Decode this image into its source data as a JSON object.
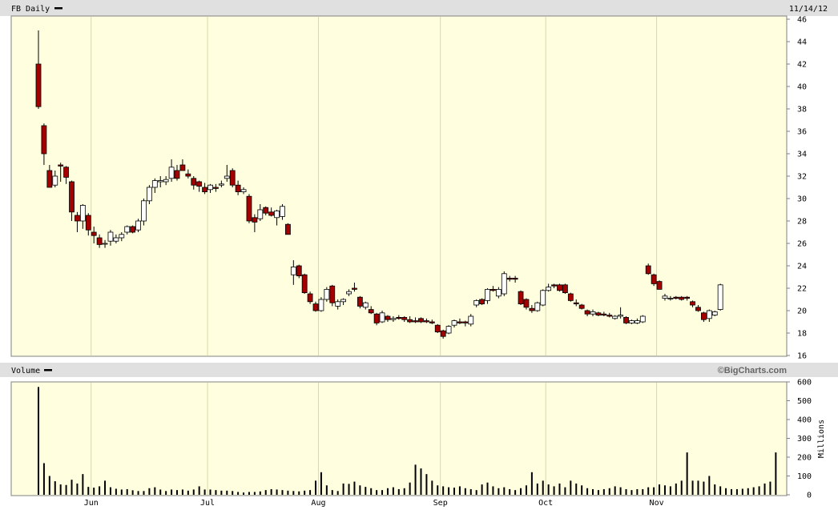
{
  "header": {
    "title": "FB Daily",
    "date": "11/14/12",
    "volume_title": "Volume",
    "copyright": "©BigCharts.com"
  },
  "colors": {
    "panel_bg": "#ffffe0",
    "grid": "#d8d8a0",
    "down": "#a40000",
    "up": "#ffffff",
    "header_bg": "#e0e0e0"
  },
  "chart_data": [
    {
      "type": "candlestick",
      "title": "FB Daily",
      "ylim": [
        16,
        46
      ],
      "yticks": [
        16,
        18,
        20,
        22,
        24,
        26,
        28,
        30,
        32,
        34,
        36,
        38,
        40,
        42,
        44,
        46
      ],
      "x_labels": [
        {
          "label": "Jun",
          "index": 10
        },
        {
          "label": "Jul",
          "index": 31
        },
        {
          "label": "Aug",
          "index": 51
        },
        {
          "label": "Sep",
          "index": 73
        },
        {
          "label": "Oct",
          "index": 92
        },
        {
          "label": "Nov",
          "index": 112
        }
      ],
      "ohlc": [
        [
          42.0,
          45.0,
          38.0,
          38.2
        ],
        [
          36.5,
          36.7,
          33.0,
          34.0
        ],
        [
          32.5,
          33.0,
          31.0,
          31.0
        ],
        [
          31.2,
          32.5,
          31.0,
          32.0
        ],
        [
          33.0,
          33.2,
          31.5,
          32.9
        ],
        [
          32.8,
          32.9,
          31.3,
          31.9
        ],
        [
          31.5,
          31.6,
          28.0,
          28.8
        ],
        [
          28.5,
          28.8,
          27.0,
          28.0
        ],
        [
          28.0,
          29.5,
          27.3,
          29.4
        ],
        [
          28.5,
          28.7,
          26.7,
          27.2
        ],
        [
          27.0,
          27.5,
          26.0,
          26.7
        ],
        [
          26.5,
          26.8,
          25.6,
          25.9
        ],
        [
          26.0,
          26.3,
          25.6,
          26.0
        ],
        [
          26.2,
          27.2,
          25.8,
          27.0
        ],
        [
          26.2,
          26.8,
          26.0,
          26.5
        ],
        [
          26.5,
          27.0,
          26.2,
          26.8
        ],
        [
          27.0,
          27.6,
          26.8,
          27.5
        ],
        [
          27.5,
          27.6,
          26.9,
          27.0
        ],
        [
          27.2,
          28.2,
          27.0,
          28.0
        ],
        [
          28.0,
          30.0,
          27.6,
          29.8
        ],
        [
          29.8,
          31.2,
          29.5,
          31.0
        ],
        [
          31.0,
          31.8,
          30.5,
          31.6
        ],
        [
          31.5,
          32.0,
          31.0,
          31.6
        ],
        [
          31.5,
          32.0,
          31.2,
          31.7
        ],
        [
          31.8,
          33.5,
          31.5,
          32.8
        ],
        [
          32.5,
          33.0,
          31.6,
          31.8
        ],
        [
          33.0,
          33.5,
          32.5,
          32.5
        ],
        [
          32.2,
          32.6,
          31.8,
          32.0
        ],
        [
          31.8,
          32.0,
          30.8,
          31.2
        ],
        [
          31.5,
          31.6,
          30.6,
          31.1
        ],
        [
          31.0,
          31.4,
          30.4,
          30.6
        ],
        [
          30.8,
          31.3,
          30.5,
          31.2
        ],
        [
          31.0,
          31.3,
          30.6,
          30.9
        ],
        [
          31.2,
          31.6,
          31.0,
          31.3
        ],
        [
          31.8,
          33.0,
          31.5,
          32.0
        ],
        [
          32.5,
          32.7,
          31.0,
          31.2
        ],
        [
          31.2,
          31.6,
          30.3,
          30.6
        ],
        [
          30.6,
          31.0,
          30.4,
          30.8
        ],
        [
          30.2,
          30.4,
          27.8,
          28.0
        ],
        [
          28.3,
          28.6,
          27.0,
          27.9
        ],
        [
          28.2,
          29.5,
          28.0,
          29.0
        ],
        [
          29.2,
          29.3,
          28.5,
          28.7
        ],
        [
          28.8,
          29.2,
          28.4,
          28.5
        ],
        [
          28.3,
          29.0,
          27.6,
          28.9
        ],
        [
          28.4,
          29.5,
          28.1,
          29.3
        ],
        [
          27.7,
          27.8,
          26.8,
          26.8
        ],
        [
          23.2,
          24.5,
          22.3,
          23.9
        ],
        [
          24.0,
          24.1,
          22.9,
          23.1
        ],
        [
          23.2,
          23.3,
          21.5,
          21.6
        ],
        [
          21.5,
          21.7,
          20.6,
          20.8
        ],
        [
          20.6,
          20.8,
          19.9,
          20.0
        ],
        [
          20.0,
          21.2,
          19.9,
          21.0
        ],
        [
          21.0,
          22.1,
          20.8,
          21.9
        ],
        [
          22.2,
          22.3,
          20.4,
          20.7
        ],
        [
          20.4,
          21.0,
          20.1,
          20.8
        ],
        [
          20.8,
          21.1,
          20.5,
          21.0
        ],
        [
          21.5,
          21.9,
          21.3,
          21.7
        ],
        [
          22.0,
          22.5,
          21.7,
          21.9
        ],
        [
          21.2,
          21.3,
          20.2,
          20.4
        ],
        [
          20.3,
          20.8,
          20.1,
          20.7
        ],
        [
          20.1,
          20.4,
          19.7,
          19.8
        ],
        [
          19.7,
          19.8,
          18.7,
          18.9
        ],
        [
          19.0,
          20.0,
          18.9,
          19.8
        ],
        [
          19.5,
          19.6,
          19.0,
          19.2
        ],
        [
          19.2,
          19.5,
          19.0,
          19.3
        ],
        [
          19.4,
          19.6,
          19.2,
          19.3
        ],
        [
          19.4,
          19.5,
          19.0,
          19.2
        ],
        [
          19.2,
          19.5,
          18.9,
          19.0
        ],
        [
          19.1,
          19.4,
          18.9,
          19.0
        ],
        [
          19.3,
          19.4,
          18.9,
          19.0
        ],
        [
          19.1,
          19.3,
          18.9,
          19.0
        ],
        [
          19.0,
          19.2,
          18.8,
          18.9
        ],
        [
          18.7,
          18.8,
          18.0,
          18.1
        ],
        [
          18.2,
          18.3,
          17.5,
          17.7
        ],
        [
          18.0,
          18.7,
          17.9,
          18.6
        ],
        [
          18.7,
          19.2,
          18.5,
          19.1
        ],
        [
          19.0,
          19.3,
          18.8,
          18.9
        ],
        [
          19.0,
          19.1,
          18.6,
          18.9
        ],
        [
          18.8,
          19.7,
          18.6,
          19.5
        ],
        [
          20.5,
          21.0,
          20.3,
          20.9
        ],
        [
          21.0,
          21.1,
          20.5,
          20.6
        ],
        [
          20.9,
          22.0,
          20.6,
          21.9
        ],
        [
          21.9,
          22.2,
          21.7,
          21.8
        ],
        [
          21.3,
          22.1,
          21.1,
          21.9
        ],
        [
          21.5,
          23.5,
          21.3,
          23.3
        ],
        [
          22.9,
          23.1,
          22.6,
          22.8
        ],
        [
          22.9,
          23.1,
          22.5,
          22.8
        ],
        [
          21.7,
          21.8,
          20.5,
          20.6
        ],
        [
          21.0,
          21.1,
          20.1,
          20.3
        ],
        [
          20.2,
          20.5,
          19.8,
          20.0
        ],
        [
          20.0,
          20.8,
          19.9,
          20.7
        ],
        [
          20.5,
          21.9,
          20.4,
          21.8
        ],
        [
          21.8,
          22.4,
          21.7,
          22.1
        ],
        [
          22.3,
          22.4,
          22.0,
          22.2
        ],
        [
          22.3,
          22.4,
          21.7,
          21.8
        ],
        [
          22.3,
          22.4,
          21.5,
          21.6
        ],
        [
          21.5,
          21.6,
          20.8,
          20.9
        ],
        [
          20.7,
          21.0,
          20.4,
          20.6
        ],
        [
          20.5,
          20.6,
          20.1,
          20.2
        ],
        [
          20.0,
          20.1,
          19.5,
          19.7
        ],
        [
          19.7,
          20.1,
          19.5,
          19.9
        ],
        [
          19.8,
          19.9,
          19.5,
          19.6
        ],
        [
          19.7,
          19.9,
          19.5,
          19.6
        ],
        [
          19.6,
          19.8,
          19.4,
          19.5
        ],
        [
          19.3,
          19.6,
          19.2,
          19.5
        ],
        [
          19.5,
          20.3,
          19.3,
          19.6
        ],
        [
          19.4,
          19.5,
          18.8,
          18.9
        ],
        [
          18.9,
          19.2,
          18.8,
          19.1
        ],
        [
          18.9,
          19.3,
          18.8,
          19.1
        ],
        [
          19.0,
          19.6,
          18.9,
          19.5
        ],
        [
          24.0,
          24.2,
          23.2,
          23.3
        ],
        [
          23.2,
          23.3,
          22.2,
          22.4
        ],
        [
          22.6,
          22.7,
          21.9,
          21.9
        ],
        [
          21.1,
          21.5,
          20.9,
          21.3
        ],
        [
          21.1,
          21.3,
          20.9,
          21.1
        ],
        [
          21.2,
          21.3,
          21.0,
          21.1
        ],
        [
          21.2,
          21.3,
          20.9,
          21.0
        ],
        [
          21.2,
          21.3,
          20.9,
          21.1
        ],
        [
          20.8,
          20.9,
          20.3,
          20.5
        ],
        [
          20.3,
          20.5,
          19.9,
          20.0
        ],
        [
          19.8,
          19.9,
          19.0,
          19.2
        ],
        [
          19.3,
          20.1,
          19.0,
          20.0
        ],
        [
          19.6,
          20.0,
          19.5,
          19.9
        ],
        [
          20.1,
          22.4,
          20.0,
          22.3
        ]
      ]
    },
    {
      "type": "bar",
      "title": "Volume",
      "ylabel": "Millions",
      "ylim": [
        0,
        600
      ],
      "yticks": [
        0,
        100,
        200,
        300,
        400,
        500,
        600
      ],
      "values": [
        573,
        168,
        100,
        72,
        55,
        52,
        80,
        60,
        110,
        42,
        38,
        45,
        75,
        40,
        32,
        28,
        30,
        24,
        20,
        20,
        35,
        40,
        28,
        20,
        28,
        25,
        28,
        22,
        28,
        45,
        28,
        28,
        25,
        22,
        22,
        20,
        15,
        12,
        15,
        15,
        18,
        25,
        30,
        28,
        25,
        22,
        20,
        18,
        22,
        25,
        75,
        120,
        50,
        25,
        20,
        60,
        58,
        70,
        50,
        42,
        35,
        25,
        25,
        35,
        40,
        30,
        35,
        65,
        160,
        140,
        110,
        75,
        50,
        45,
        40,
        38,
        45,
        35,
        30,
        25,
        55,
        65,
        45,
        35,
        40,
        30,
        25,
        35,
        50,
        120,
        60,
        75,
        55,
        45,
        60,
        40,
        75,
        60,
        50,
        35,
        30,
        25,
        30,
        35,
        45,
        40,
        30,
        25,
        30,
        30,
        40,
        40,
        55,
        50,
        45,
        60,
        75,
        225,
        75,
        75,
        70,
        100,
        55,
        45,
        35,
        30,
        30,
        32,
        35,
        40,
        45,
        60,
        70,
        225
      ]
    }
  ]
}
